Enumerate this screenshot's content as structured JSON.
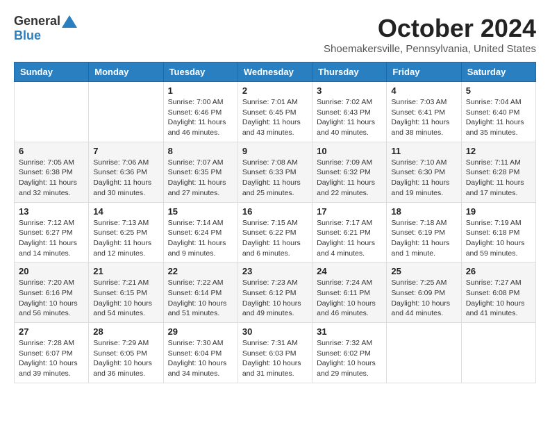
{
  "header": {
    "logo_general": "General",
    "logo_blue": "Blue",
    "month_title": "October 2024",
    "subtitle": "Shoemakersville, Pennsylvania, United States"
  },
  "days_of_week": [
    "Sunday",
    "Monday",
    "Tuesday",
    "Wednesday",
    "Thursday",
    "Friday",
    "Saturday"
  ],
  "weeks": [
    [
      {
        "day": "",
        "info": ""
      },
      {
        "day": "",
        "info": ""
      },
      {
        "day": "1",
        "info": "Sunrise: 7:00 AM\nSunset: 6:46 PM\nDaylight: 11 hours and 46 minutes."
      },
      {
        "day": "2",
        "info": "Sunrise: 7:01 AM\nSunset: 6:45 PM\nDaylight: 11 hours and 43 minutes."
      },
      {
        "day": "3",
        "info": "Sunrise: 7:02 AM\nSunset: 6:43 PM\nDaylight: 11 hours and 40 minutes."
      },
      {
        "day": "4",
        "info": "Sunrise: 7:03 AM\nSunset: 6:41 PM\nDaylight: 11 hours and 38 minutes."
      },
      {
        "day": "5",
        "info": "Sunrise: 7:04 AM\nSunset: 6:40 PM\nDaylight: 11 hours and 35 minutes."
      }
    ],
    [
      {
        "day": "6",
        "info": "Sunrise: 7:05 AM\nSunset: 6:38 PM\nDaylight: 11 hours and 32 minutes."
      },
      {
        "day": "7",
        "info": "Sunrise: 7:06 AM\nSunset: 6:36 PM\nDaylight: 11 hours and 30 minutes."
      },
      {
        "day": "8",
        "info": "Sunrise: 7:07 AM\nSunset: 6:35 PM\nDaylight: 11 hours and 27 minutes."
      },
      {
        "day": "9",
        "info": "Sunrise: 7:08 AM\nSunset: 6:33 PM\nDaylight: 11 hours and 25 minutes."
      },
      {
        "day": "10",
        "info": "Sunrise: 7:09 AM\nSunset: 6:32 PM\nDaylight: 11 hours and 22 minutes."
      },
      {
        "day": "11",
        "info": "Sunrise: 7:10 AM\nSunset: 6:30 PM\nDaylight: 11 hours and 19 minutes."
      },
      {
        "day": "12",
        "info": "Sunrise: 7:11 AM\nSunset: 6:28 PM\nDaylight: 11 hours and 17 minutes."
      }
    ],
    [
      {
        "day": "13",
        "info": "Sunrise: 7:12 AM\nSunset: 6:27 PM\nDaylight: 11 hours and 14 minutes."
      },
      {
        "day": "14",
        "info": "Sunrise: 7:13 AM\nSunset: 6:25 PM\nDaylight: 11 hours and 12 minutes."
      },
      {
        "day": "15",
        "info": "Sunrise: 7:14 AM\nSunset: 6:24 PM\nDaylight: 11 hours and 9 minutes."
      },
      {
        "day": "16",
        "info": "Sunrise: 7:15 AM\nSunset: 6:22 PM\nDaylight: 11 hours and 6 minutes."
      },
      {
        "day": "17",
        "info": "Sunrise: 7:17 AM\nSunset: 6:21 PM\nDaylight: 11 hours and 4 minutes."
      },
      {
        "day": "18",
        "info": "Sunrise: 7:18 AM\nSunset: 6:19 PM\nDaylight: 11 hours and 1 minute."
      },
      {
        "day": "19",
        "info": "Sunrise: 7:19 AM\nSunset: 6:18 PM\nDaylight: 10 hours and 59 minutes."
      }
    ],
    [
      {
        "day": "20",
        "info": "Sunrise: 7:20 AM\nSunset: 6:16 PM\nDaylight: 10 hours and 56 minutes."
      },
      {
        "day": "21",
        "info": "Sunrise: 7:21 AM\nSunset: 6:15 PM\nDaylight: 10 hours and 54 minutes."
      },
      {
        "day": "22",
        "info": "Sunrise: 7:22 AM\nSunset: 6:14 PM\nDaylight: 10 hours and 51 minutes."
      },
      {
        "day": "23",
        "info": "Sunrise: 7:23 AM\nSunset: 6:12 PM\nDaylight: 10 hours and 49 minutes."
      },
      {
        "day": "24",
        "info": "Sunrise: 7:24 AM\nSunset: 6:11 PM\nDaylight: 10 hours and 46 minutes."
      },
      {
        "day": "25",
        "info": "Sunrise: 7:25 AM\nSunset: 6:09 PM\nDaylight: 10 hours and 44 minutes."
      },
      {
        "day": "26",
        "info": "Sunrise: 7:27 AM\nSunset: 6:08 PM\nDaylight: 10 hours and 41 minutes."
      }
    ],
    [
      {
        "day": "27",
        "info": "Sunrise: 7:28 AM\nSunset: 6:07 PM\nDaylight: 10 hours and 39 minutes."
      },
      {
        "day": "28",
        "info": "Sunrise: 7:29 AM\nSunset: 6:05 PM\nDaylight: 10 hours and 36 minutes."
      },
      {
        "day": "29",
        "info": "Sunrise: 7:30 AM\nSunset: 6:04 PM\nDaylight: 10 hours and 34 minutes."
      },
      {
        "day": "30",
        "info": "Sunrise: 7:31 AM\nSunset: 6:03 PM\nDaylight: 10 hours and 31 minutes."
      },
      {
        "day": "31",
        "info": "Sunrise: 7:32 AM\nSunset: 6:02 PM\nDaylight: 10 hours and 29 minutes."
      },
      {
        "day": "",
        "info": ""
      },
      {
        "day": "",
        "info": ""
      }
    ]
  ]
}
